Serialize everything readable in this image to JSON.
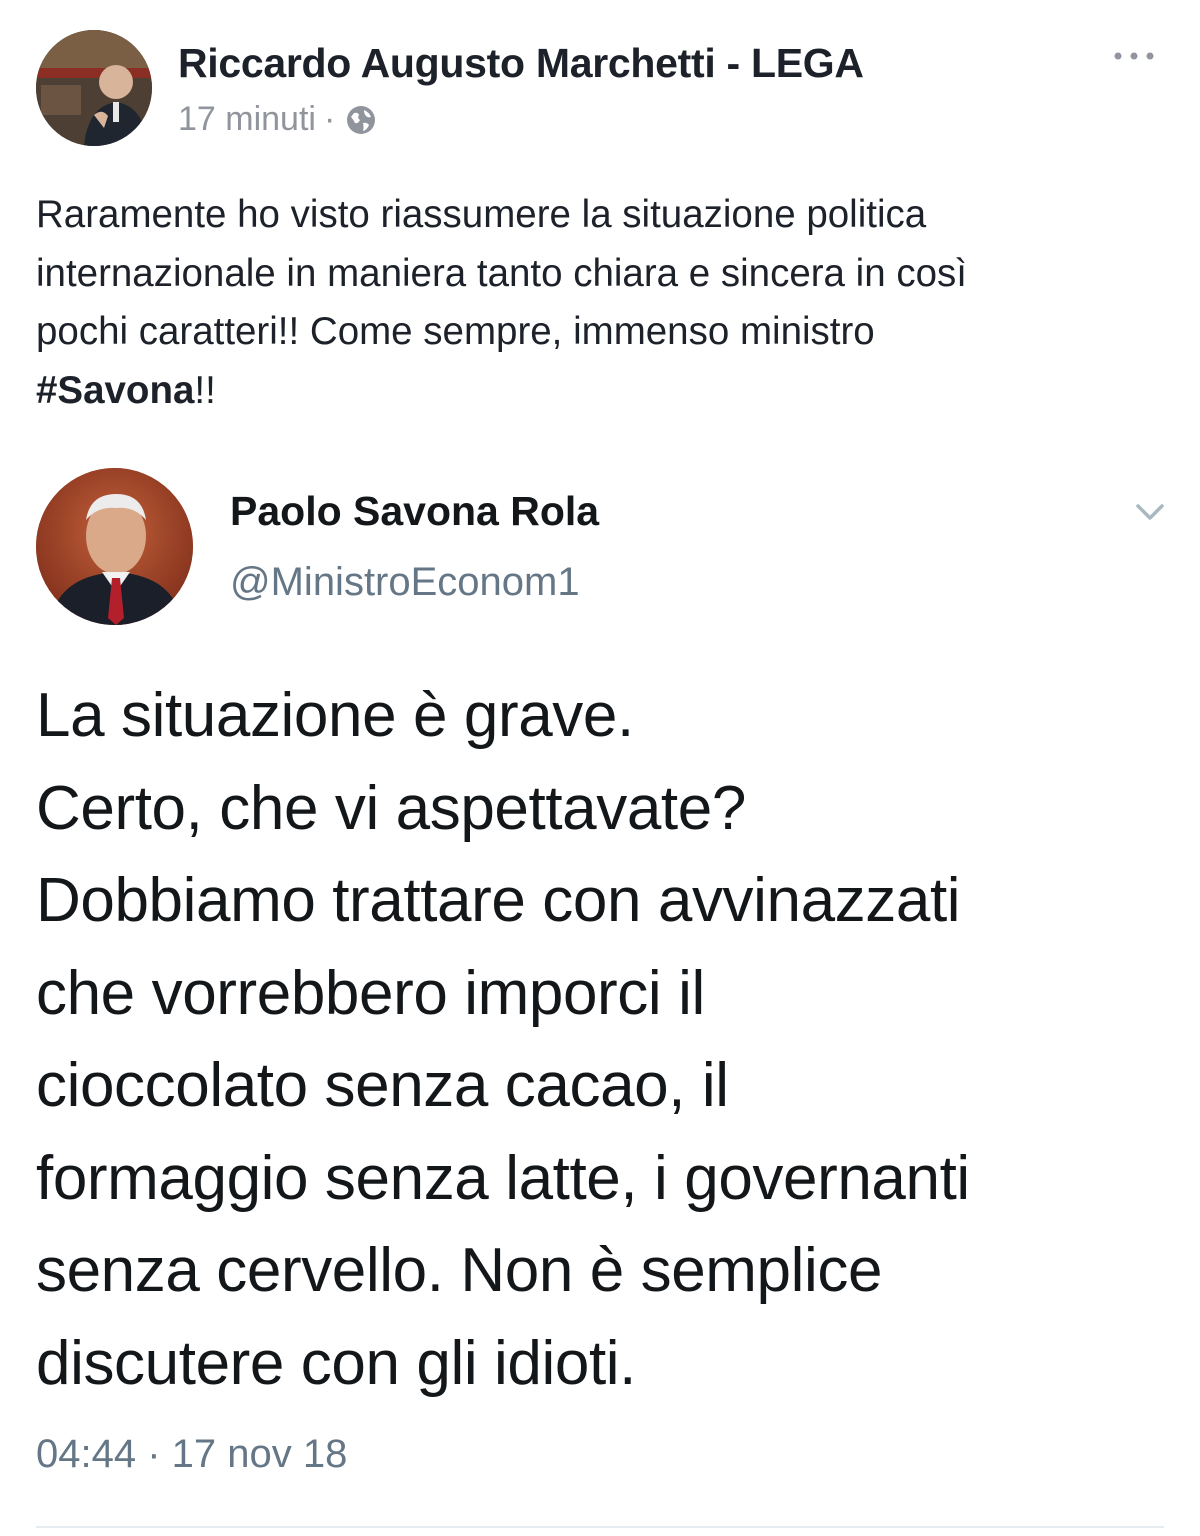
{
  "post": {
    "author": "Riccardo Augusto Marchetti - LEGA",
    "time": "17 minuti",
    "separator": "·",
    "text_lines_before": [
      "Raramente ho visto riassumere la situazione politica",
      "internazionale in maniera tanto chiara e sincera in così",
      "pochi caratteri!! Come sempre, immenso ministro"
    ],
    "hashtag_prefix": "#",
    "hashtag": "Savona",
    "hashtag_suffix": "!!",
    "icons": {
      "more": "more-horizontal-icon",
      "audience": "globe-icon"
    }
  },
  "tweet": {
    "name": "Paolo Savona Rola",
    "handle": "@MinistroEconom1",
    "lines": [
      "La situazione è grave.",
      "Certo, che vi aspettavate?",
      "Dobbiamo trattare con avvinazzati",
      "che vorrebbero imporci il",
      "cioccolato senza cacao, il",
      "formaggio senza latte, i governanti",
      "senza cervello. Non è semplice",
      "discutere con gli idioti."
    ],
    "timestamp": "04:44 · 17 nov 18",
    "icons": {
      "menu": "chevron-down-icon"
    }
  },
  "colors": {
    "text": "#1d2129",
    "meta": "#90949c",
    "tweet_text": "#14171a",
    "tweet_secondary": "#657786"
  }
}
